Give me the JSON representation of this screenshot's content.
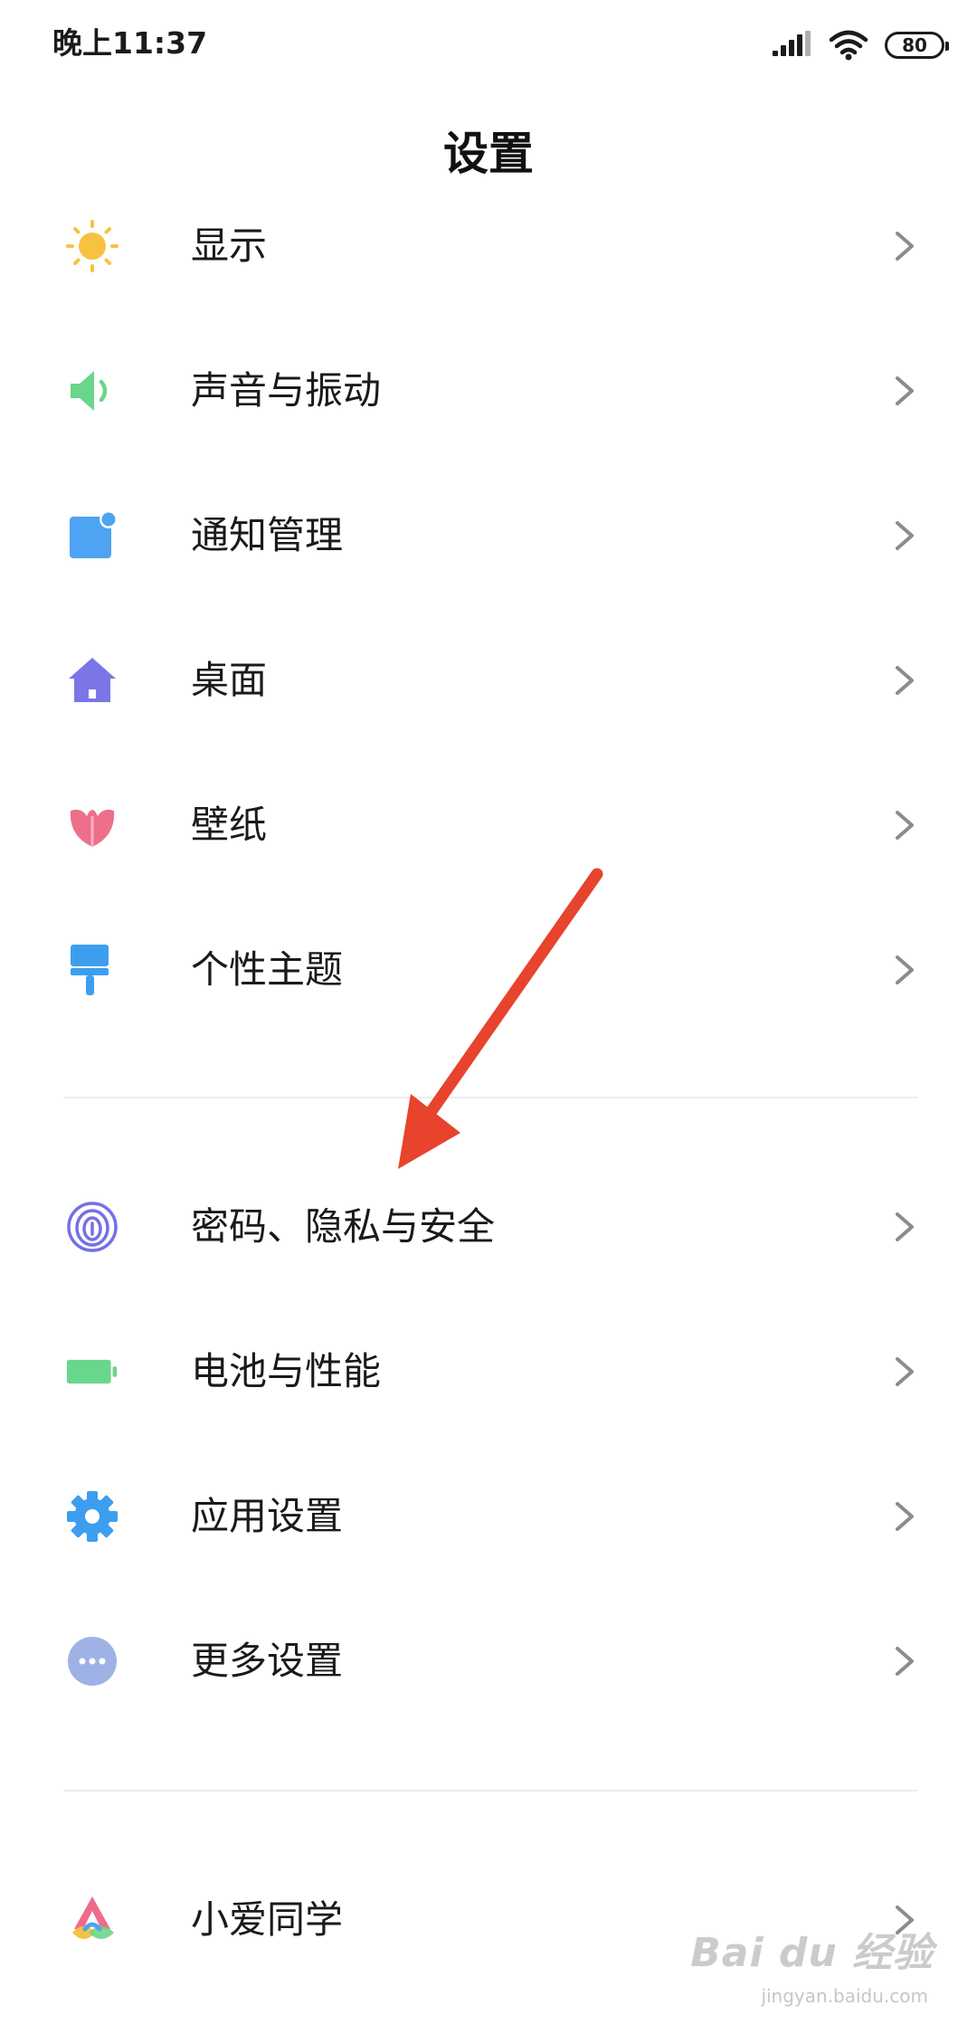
{
  "status_bar": {
    "time": "晚上11:37",
    "battery": "80"
  },
  "header": {
    "title": "设置"
  },
  "settings": {
    "group1": [
      {
        "label": "显示",
        "icon": "sun-icon",
        "color": "#f7c242"
      },
      {
        "label": "声音与振动",
        "icon": "speaker-icon",
        "color": "#6ad68b"
      },
      {
        "label": "通知管理",
        "icon": "notification-icon",
        "color": "#4ea3f2"
      },
      {
        "label": "桌面",
        "icon": "home-icon",
        "color": "#7a76e8"
      },
      {
        "label": "壁纸",
        "icon": "tulip-icon",
        "color": "#ee6f8a"
      },
      {
        "label": "个性主题",
        "icon": "paint-brush-icon",
        "color": "#3d9ef0"
      }
    ],
    "group2": [
      {
        "label": "密码、隐私与安全",
        "icon": "fingerprint-icon",
        "color": "#7570e6"
      },
      {
        "label": "电池与性能",
        "icon": "battery-icon",
        "color": "#6ad68b"
      },
      {
        "label": "应用设置",
        "icon": "gear-icon",
        "color": "#3d9ef0"
      },
      {
        "label": "更多设置",
        "icon": "more-icon",
        "color": "#9fb2e6"
      }
    ],
    "group3": [
      {
        "label": "小爱同学",
        "icon": "xiaoai-icon",
        "color": "#ef6b8a"
      }
    ]
  },
  "annotation": {
    "arrow_color": "#e8432c"
  },
  "watermark": {
    "brand": "Bai du 经验",
    "url": "jingyan.baidu.com"
  }
}
